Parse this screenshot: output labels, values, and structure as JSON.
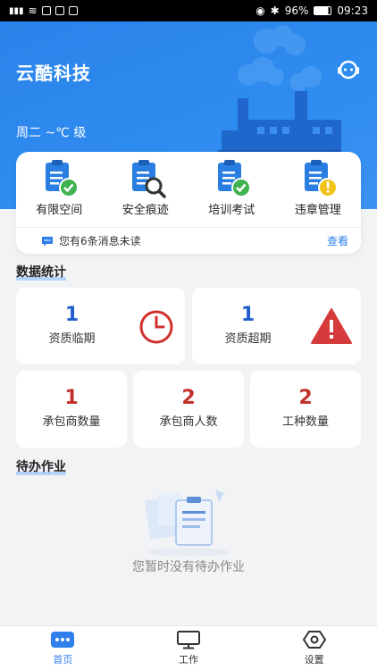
{
  "status_bar": {
    "battery": "96%",
    "time": "09:23"
  },
  "header": {
    "company": "云酷科技",
    "weather": "周二 ~℃ 级"
  },
  "quick_actions": [
    {
      "label": "有限空间",
      "icon": "clipboard-check-icon"
    },
    {
      "label": "安全痕迹",
      "icon": "clipboard-search-icon"
    },
    {
      "label": "培训考试",
      "icon": "clipboard-check-icon"
    },
    {
      "label": "违章管理",
      "icon": "clipboard-warning-icon"
    }
  ],
  "notice": {
    "message": "您有6条消息未读",
    "action": "查看"
  },
  "data_stats": {
    "title": "数据统计",
    "expiring": {
      "value": "1",
      "label": "资质临期"
    },
    "expired": {
      "value": "1",
      "label": "资质超期"
    },
    "contractors": {
      "value": "1",
      "label": "承包商数量"
    },
    "contractor_people": {
      "value": "2",
      "label": "承包商人数"
    },
    "job_types": {
      "value": "2",
      "label": "工种数量"
    }
  },
  "todo": {
    "title": "待办作业",
    "empty_text": "您暂时没有待办作业"
  },
  "tabs": [
    {
      "label": "首页",
      "active": true
    },
    {
      "label": "工作",
      "active": false
    },
    {
      "label": "设置",
      "active": false
    }
  ],
  "colors": {
    "primary": "#2f80ed",
    "blue_num": "#1f5fd0",
    "red_num": "#c0302a",
    "danger": "#d63b3b"
  }
}
